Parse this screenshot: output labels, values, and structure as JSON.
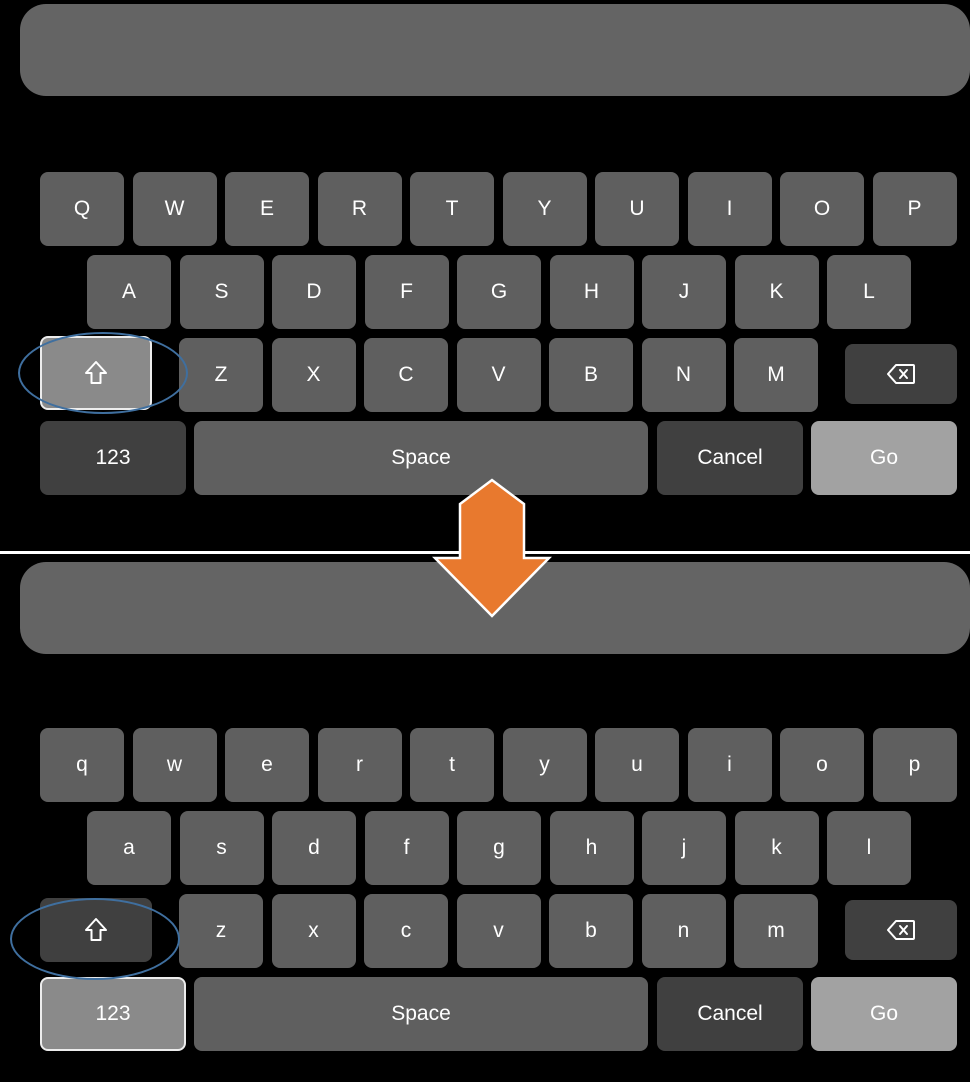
{
  "accent_color": "#e8792e",
  "before": {
    "rows": [
      [
        "Q",
        "W",
        "E",
        "R",
        "T",
        "Y",
        "U",
        "I",
        "O",
        "P"
      ],
      [
        "A",
        "S",
        "D",
        "F",
        "G",
        "H",
        "J",
        "K",
        "L"
      ],
      [
        "Z",
        "X",
        "C",
        "V",
        "B",
        "N",
        "M"
      ]
    ],
    "shift_state": "pressed",
    "numbers_key": "123",
    "space_key": "Space",
    "cancel_key": "Cancel",
    "go_key": "Go",
    "shift_icon": "shift-arrow-icon",
    "backspace_icon": "backspace-icon"
  },
  "after": {
    "rows": [
      [
        "q",
        "w",
        "e",
        "r",
        "t",
        "y",
        "u",
        "i",
        "o",
        "p"
      ],
      [
        "a",
        "s",
        "d",
        "f",
        "g",
        "h",
        "j",
        "k",
        "l"
      ],
      [
        "z",
        "x",
        "c",
        "v",
        "b",
        "n",
        "m"
      ]
    ],
    "shift_state": "released",
    "numbers_state": "pressed",
    "numbers_key": "123",
    "space_key": "Space",
    "cancel_key": "Cancel",
    "go_key": "Go",
    "shift_icon": "shift-arrow-icon",
    "backspace_icon": "backspace-icon"
  },
  "transition_icon": "down-arrow-icon"
}
